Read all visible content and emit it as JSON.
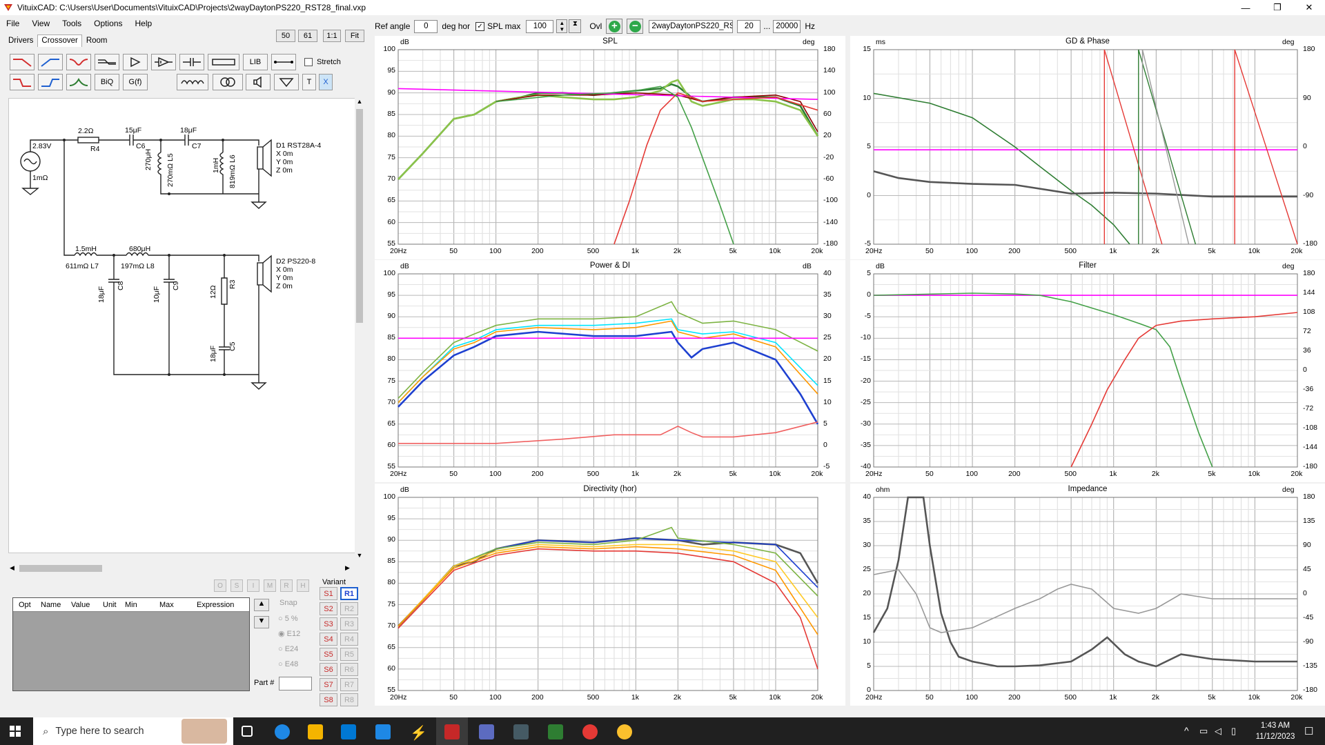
{
  "window": {
    "title": "VituixCAD: C:\\Users\\User\\Documents\\VituixCAD\\Projects\\2wayDaytonPS220_RST28_final.vxp",
    "minimize": "—",
    "maximize": "❐",
    "close": "✕"
  },
  "menu": [
    "File",
    "View",
    "Tools",
    "Options",
    "Help"
  ],
  "tabs": [
    "Drivers",
    "Crossover",
    "Room"
  ],
  "zoom_buttons": [
    "50",
    "61",
    "1:1",
    "Fit"
  ],
  "tools": {
    "lib": "LIB",
    "stretch": "Stretch",
    "biq": "BiQ",
    "gf": "G(f)",
    "t": "T",
    "x": "X"
  },
  "schematic": {
    "source_v": "2.83V",
    "source_r": "1mΩ",
    "r4_val": "2.2Ω",
    "r4_name": "R4",
    "c6_val": "15μF",
    "c6_name": "C6",
    "c7_val": "18μF",
    "c7_name": "C7",
    "l5_val": "270μH",
    "l5_name": "270mΩ L5",
    "l6_val": "1mH",
    "l6_name": "819mΩ L6",
    "d1_name": "D1 RST28A-4",
    "d1_x": "X 0m",
    "d1_y": "Y 0m",
    "d1_z": "Z 0m",
    "l7_val": "1.5mH",
    "l7_name": "611mΩ L7",
    "l8_val": "680μH",
    "l8_name": "197mΩ L8",
    "c8_val": "18μF",
    "c8_name": "C8",
    "c9_val": "10μF",
    "c9_name": "C9",
    "r3_val": "12Ω",
    "r3_name": "R3",
    "c5_val": "18μF",
    "c5_name": "C5",
    "d2_name": "D2 PS220-8",
    "d2_x": "X 0m",
    "d2_y": "Y 0m",
    "d2_z": "Z 0m"
  },
  "opt_buttons": [
    "O",
    "S",
    "I",
    "M",
    "R",
    "H"
  ],
  "param_table": {
    "columns": [
      "Opt",
      "Name",
      "Value",
      "Unit",
      "Min",
      "Max",
      "Expression"
    ]
  },
  "snap": {
    "label": "Snap",
    "options": [
      "5 %",
      "E12",
      "E24",
      "E48"
    ],
    "selected": "E12"
  },
  "part_label": "Part #",
  "variant": {
    "label": "Variant",
    "s": [
      "S1",
      "S2",
      "S3",
      "S4",
      "S5",
      "S6",
      "S7",
      "S8"
    ],
    "r": [
      "R1",
      "R2",
      "R3",
      "R4",
      "R5",
      "R6",
      "R7",
      "R8"
    ]
  },
  "toolbar": {
    "ref_angle_label": "Ref angle",
    "ref_angle": "0",
    "deg_hor": "deg hor",
    "spl_max_label": "SPL max",
    "spl_max": "100",
    "ovl": "Ovl",
    "project": "2wayDaytonPS220_RS",
    "f_min": "20",
    "dots": "...",
    "f_max": "20000",
    "hz": "Hz"
  },
  "freq_ticks": [
    "20Hz",
    "50",
    "100",
    "200",
    "500",
    "1k",
    "2k",
    "5k",
    "10k",
    "20k"
  ],
  "graphs": {
    "spl": {
      "title": "SPL",
      "lunit": "dB",
      "runit": "deg",
      "left": [
        "100",
        "95",
        "90",
        "85",
        "80",
        "75",
        "70",
        "65",
        "60",
        "55"
      ],
      "right": [
        "180",
        "140",
        "100",
        "60",
        "20",
        "-20",
        "-60",
        "-100",
        "-140",
        "-180"
      ]
    },
    "power": {
      "title": "Power & DI",
      "lunit": "dB",
      "runit": "dB",
      "left": [
        "100",
        "95",
        "90",
        "85",
        "80",
        "75",
        "70",
        "65",
        "60",
        "55"
      ],
      "right": [
        "40",
        "35",
        "30",
        "25",
        "20",
        "15",
        "10",
        "5",
        "0",
        "-5"
      ]
    },
    "dir": {
      "title": "Directivity (hor)",
      "lunit": "dB",
      "runit": "",
      "left": [
        "100",
        "95",
        "90",
        "85",
        "80",
        "75",
        "70",
        "65",
        "60",
        "55"
      ],
      "right": []
    },
    "gd": {
      "title": "GD & Phase",
      "lunit": "ms",
      "runit": "deg",
      "left": [
        "15",
        "10",
        "5",
        "0",
        "-5"
      ],
      "right": [
        "180",
        "90",
        "0",
        "-90",
        "-180"
      ]
    },
    "filter": {
      "title": "Filter",
      "lunit": "dB",
      "runit": "deg",
      "left": [
        "5",
        "0",
        "-5",
        "-10",
        "-15",
        "-20",
        "-25",
        "-30",
        "-35",
        "-40"
      ],
      "right": [
        "180",
        "144",
        "108",
        "72",
        "36",
        "0",
        "-36",
        "-72",
        "-108",
        "-144",
        "-180"
      ]
    },
    "imp": {
      "title": "Impedance",
      "lunit": "ohm",
      "runit": "deg",
      "left": [
        "40",
        "35",
        "30",
        "25",
        "20",
        "15",
        "10",
        "5",
        "0"
      ],
      "right": [
        "180",
        "135",
        "90",
        "45",
        "0",
        "-45",
        "-90",
        "-135",
        "-180"
      ]
    }
  },
  "chart_data": [
    {
      "type": "line",
      "title": "SPL",
      "xlabel": "Hz",
      "ylabel": "dB",
      "xscale": "log",
      "xlim": [
        20,
        20000
      ],
      "ylim": [
        55,
        100
      ],
      "y2lim": [
        -180,
        180
      ],
      "y2label": "deg",
      "series": [
        {
          "color": "#2e7d32",
          "x": [
            20,
            30,
            50,
            70,
            100,
            150,
            200,
            300,
            500,
            700,
            1000,
            1500,
            1800,
            2000,
            2500,
            3000,
            5000,
            7000,
            10000,
            15000,
            20000
          ],
          "y": [
            70,
            76,
            84,
            85,
            88,
            89,
            90,
            90,
            89.5,
            90,
            90.5,
            91,
            92,
            91.5,
            89,
            88,
            89,
            89,
            89,
            87,
            80
          ]
        },
        {
          "color": "#8bc34a",
          "x": [
            20,
            30,
            50,
            70,
            100,
            150,
            200,
            300,
            500,
            700,
            1000,
            1500,
            1800,
            2000,
            2500,
            3000,
            5000,
            7000,
            10000,
            15000,
            20000
          ],
          "y": [
            70,
            76,
            84,
            85,
            88,
            89,
            89.5,
            89,
            88.5,
            88.5,
            89,
            90.5,
            92.5,
            93,
            88,
            87,
            88.5,
            88.5,
            88,
            86,
            80
          ]
        },
        {
          "color": "#8b0000",
          "x": [
            100,
            200,
            500,
            1000,
            2000,
            3000,
            5000,
            10000,
            15000,
            20000
          ],
          "y": [
            88,
            89.5,
            89.5,
            90,
            89.5,
            88,
            89,
            89.5,
            88,
            81
          ]
        },
        {
          "color": "#ff00ff",
          "x": [
            20,
            20000
          ],
          "y": [
            91,
            88.5
          ]
        },
        {
          "color": "#e53935",
          "x": [
            700,
            900,
            1200,
            1500,
            2000,
            2500,
            3000,
            5000,
            10000,
            20000
          ],
          "y": [
            55,
            65,
            78,
            86,
            90,
            89,
            88,
            88.5,
            89,
            86
          ]
        },
        {
          "color": "#43a047",
          "x": [
            100,
            300,
            700,
            1000,
            1500,
            2000,
            2500,
            3000,
            4000,
            5000
          ],
          "y": [
            88,
            89.5,
            90,
            90.5,
            91.5,
            89,
            82,
            75,
            64,
            55
          ]
        }
      ]
    },
    {
      "type": "line",
      "title": "Power & DI",
      "xlabel": "Hz",
      "ylabel": "dB",
      "xscale": "log",
      "xlim": [
        20,
        20000
      ],
      "ylim": [
        55,
        100
      ],
      "y2lim": [
        -5,
        40
      ],
      "series": [
        {
          "color": "#7cb342",
          "x": [
            20,
            30,
            50,
            70,
            100,
            200,
            500,
            1000,
            1800,
            2000,
            3000,
            5000,
            10000,
            20000
          ],
          "y": [
            71,
            77,
            84,
            86,
            88,
            89.5,
            89.5,
            90,
            93.5,
            91,
            88.5,
            89,
            87,
            82
          ]
        },
        {
          "color": "#00e5ff",
          "x": [
            20,
            30,
            50,
            70,
            100,
            200,
            500,
            1000,
            1800,
            2000,
            3000,
            5000,
            10000,
            20000
          ],
          "y": [
            70,
            76,
            83,
            84.5,
            87,
            88,
            88,
            88.5,
            89.5,
            87,
            86,
            86.5,
            84,
            74
          ]
        },
        {
          "color": "#ff9800",
          "x": [
            20,
            30,
            50,
            70,
            100,
            200,
            500,
            1000,
            1800,
            2000,
            3000,
            5000,
            10000,
            20000
          ],
          "y": [
            70,
            76,
            82.5,
            84,
            86.5,
            87.5,
            87,
            87.5,
            89,
            86.5,
            85,
            86,
            83,
            72
          ]
        },
        {
          "color": "#1e40d0",
          "x": [
            20,
            30,
            50,
            70,
            100,
            200,
            500,
            1000,
            1800,
            2000,
            2500,
            3000,
            5000,
            10000,
            15000,
            20000
          ],
          "y": [
            69,
            75,
            81,
            83,
            85.5,
            86.5,
            85.5,
            85.5,
            86.5,
            84,
            80.5,
            82.5,
            84,
            80,
            72,
            65
          ]
        },
        {
          "color": "#ff00ff",
          "x": [
            20,
            20000
          ],
          "y": [
            85,
            85
          ]
        },
        {
          "color": "#f06060",
          "x": [
            20,
            100,
            300,
            700,
            1000,
            1500,
            2000,
            2500,
            3000,
            5000,
            10000,
            20000
          ],
          "y": [
            60.5,
            60.5,
            61.5,
            62.5,
            62.5,
            62.5,
            64.5,
            63,
            62,
            62,
            63,
            65.5
          ]
        }
      ]
    },
    {
      "type": "line",
      "title": "Directivity (hor)",
      "xlabel": "Hz",
      "ylabel": "dB",
      "xscale": "log",
      "xlim": [
        20,
        20000
      ],
      "ylim": [
        55,
        100
      ],
      "series": [
        {
          "color": "#555555",
          "x": [
            20,
            30,
            50,
            70,
            100,
            200,
            500,
            1000,
            2000,
            3000,
            5000,
            10000,
            15000,
            20000
          ],
          "y": [
            70,
            76,
            84,
            85,
            88,
            90,
            89.5,
            90.5,
            90,
            89,
            89.5,
            89,
            87,
            80
          ]
        },
        {
          "color": "#1e40d0",
          "x": [
            20,
            50,
            100,
            200,
            500,
            1000,
            2000,
            5000,
            10000,
            20000
          ],
          "y": [
            70,
            84,
            88,
            90,
            89.5,
            90.5,
            90,
            89.5,
            89,
            79
          ]
        },
        {
          "color": "#7cb342",
          "x": [
            20,
            50,
            100,
            200,
            500,
            1000,
            1800,
            2000,
            5000,
            10000,
            20000
          ],
          "y": [
            70,
            84,
            88,
            89.5,
            89,
            90,
            93,
            90.5,
            89,
            87,
            77
          ]
        },
        {
          "color": "#ffca28",
          "x": [
            20,
            50,
            100,
            200,
            500,
            1000,
            2000,
            5000,
            10000,
            20000
          ],
          "y": [
            70,
            84,
            87.5,
            89,
            88.5,
            89,
            89,
            87.5,
            85,
            72
          ]
        },
        {
          "color": "#ff9800",
          "x": [
            20,
            50,
            100,
            200,
            500,
            1000,
            2000,
            5000,
            10000,
            20000
          ],
          "y": [
            70,
            83.5,
            87,
            88.5,
            88,
            88.5,
            88,
            86.5,
            83,
            68
          ]
        },
        {
          "color": "#e53935",
          "x": [
            20,
            50,
            100,
            200,
            500,
            1000,
            2000,
            5000,
            10000,
            15000,
            20000
          ],
          "y": [
            69.5,
            83,
            86.5,
            88,
            87.5,
            87.5,
            87,
            85,
            80,
            72,
            60
          ]
        }
      ]
    },
    {
      "type": "line",
      "title": "GD & Phase",
      "xlabel": "Hz",
      "ylabel": "ms",
      "xscale": "log",
      "xlim": [
        20,
        20000
      ],
      "ylim": [
        -5,
        15
      ],
      "y2lim": [
        -180,
        180
      ],
      "series": [
        {
          "color": "#2e7d32",
          "x": [
            20,
            50,
            100,
            200,
            300,
            500,
            700,
            1000,
            1300
          ],
          "y": [
            10.5,
            9.5,
            8,
            5,
            3,
            0.5,
            -1,
            -3,
            -5
          ]
        },
        {
          "color": "#555555",
          "x": [
            20,
            30,
            50,
            100,
            200,
            500,
            1000,
            2000,
            5000,
            20000
          ],
          "y": [
            2.5,
            1.8,
            1.4,
            1.2,
            1.1,
            0.2,
            0.3,
            0.2,
            -0.1,
            -0.1
          ]
        },
        {
          "color": "#ff00ff",
          "x": [
            20,
            20000
          ],
          "y": [
            4.7,
            4.7
          ]
        }
      ]
    },
    {
      "type": "line",
      "title": "Filter",
      "xlabel": "Hz",
      "ylabel": "dB",
      "xscale": "log",
      "xlim": [
        20,
        20000
      ],
      "ylim": [
        -40,
        5
      ],
      "y2lim": [
        -180,
        180
      ],
      "series": [
        {
          "color": "#ff00ff",
          "x": [
            20,
            20000
          ],
          "y": [
            0,
            0
          ]
        },
        {
          "color": "#43a047",
          "x": [
            20,
            100,
            200,
            300,
            500,
            1000,
            1500,
            2000,
            2500,
            3000,
            4000,
            5000
          ],
          "y": [
            0,
            0.5,
            0.3,
            0,
            -1.5,
            -4.5,
            -6.5,
            -8,
            -12,
            -20,
            -32,
            -40
          ]
        },
        {
          "color": "#e53935",
          "x": [
            500,
            700,
            900,
            1200,
            1500,
            2000,
            3000,
            5000,
            10000,
            20000
          ],
          "y": [
            -40,
            -30,
            -22,
            -15,
            -10,
            -7,
            -6,
            -5.5,
            -5,
            -4
          ]
        }
      ]
    },
    {
      "type": "line",
      "title": "Impedance",
      "xlabel": "Hz",
      "ylabel": "ohm",
      "xscale": "log",
      "xlim": [
        20,
        20000
      ],
      "ylim": [
        0,
        40
      ],
      "y2lim": [
        -180,
        180
      ],
      "series": [
        {
          "color": "#555555",
          "x": [
            20,
            25,
            30,
            35,
            40,
            45,
            50,
            60,
            70,
            80,
            100,
            150,
            200,
            300,
            500,
            700,
            900,
            1200,
            1500,
            2000,
            3000,
            5000,
            10000,
            20000
          ],
          "y": [
            12,
            17,
            27,
            40,
            40,
            40,
            30,
            16,
            10,
            7,
            6,
            5,
            5,
            5.2,
            6,
            8.5,
            11,
            7.5,
            6,
            5,
            7.5,
            6.5,
            6,
            6
          ]
        },
        {
          "color": "#999999",
          "x": [
            20,
            30,
            40,
            50,
            60,
            100,
            200,
            300,
            400,
            500,
            700,
            1000,
            1500,
            2000,
            3000,
            5000,
            10000,
            20000
          ],
          "y": [
            24,
            25,
            20,
            13,
            12,
            13,
            17,
            19,
            21,
            22,
            21,
            17,
            16,
            17,
            20,
            19,
            19,
            19
          ]
        }
      ]
    }
  ],
  "taskbar": {
    "search": "Type here to search",
    "time": "1:43 AM",
    "date": "11/12/2023",
    "up": "^",
    "chat": "☐"
  }
}
